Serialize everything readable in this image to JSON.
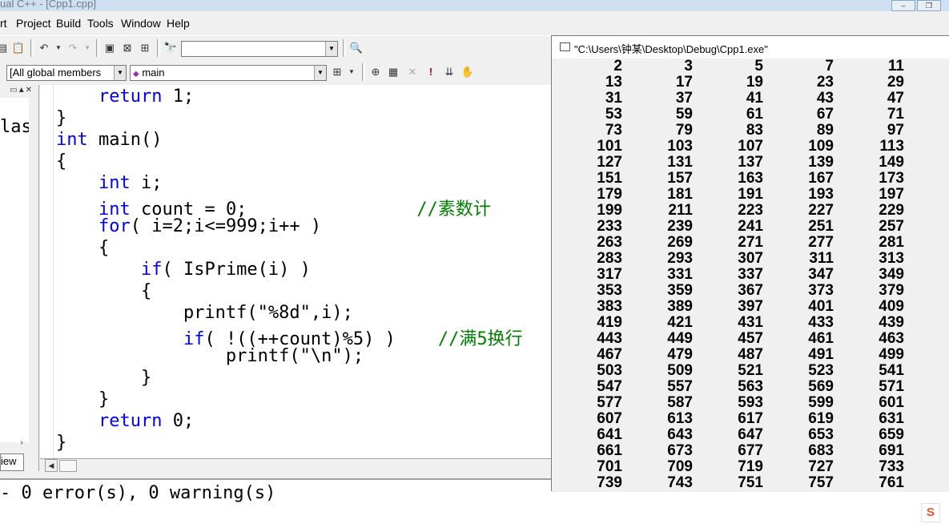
{
  "window": {
    "title": "ual C++ - [Cpp1.cpp]"
  },
  "menu": [
    "rt",
    "Project",
    "Build",
    "Tools",
    "Window",
    "Help"
  ],
  "toolbar": {
    "find_combo_value": "",
    "scope_combo": "[All global members",
    "function_combo": "main"
  },
  "left_panel": {
    "class_text": "las",
    "tab_label": "iew"
  },
  "editor": {
    "lines": [
      "    return 1;",
      "}",
      "int main()",
      "{",
      "    int i;",
      "    int count = 0;                //素数计",
      "    for( i=2;i<=999;i++ )",
      "    {",
      "        if( IsPrime(i) )",
      "        {",
      "            printf(\"%8d\",i);",
      "            if( !((++count)%5) )    //满5换行",
      "                printf(\"\\n\");",
      "        }",
      "    }",
      "    return 0;",
      "}"
    ]
  },
  "output": {
    "text": "- 0 error(s), 0 warning(s)"
  },
  "console": {
    "title": "\"C:\\Users\\钟某\\Desktop\\Debug\\Cpp1.exe\"",
    "rows": [
      [
        "2",
        "3",
        "5",
        "7",
        "11"
      ],
      [
        "13",
        "17",
        "19",
        "23",
        "29"
      ],
      [
        "31",
        "37",
        "41",
        "43",
        "47"
      ],
      [
        "53",
        "59",
        "61",
        "67",
        "71"
      ],
      [
        "73",
        "79",
        "83",
        "89",
        "97"
      ],
      [
        "101",
        "103",
        "107",
        "109",
        "113"
      ],
      [
        "127",
        "131",
        "137",
        "139",
        "149"
      ],
      [
        "151",
        "157",
        "163",
        "167",
        "173"
      ],
      [
        "179",
        "181",
        "191",
        "193",
        "197"
      ],
      [
        "199",
        "211",
        "223",
        "227",
        "229"
      ],
      [
        "233",
        "239",
        "241",
        "251",
        "257"
      ],
      [
        "263",
        "269",
        "271",
        "277",
        "281"
      ],
      [
        "283",
        "293",
        "307",
        "311",
        "313"
      ],
      [
        "317",
        "331",
        "337",
        "347",
        "349"
      ],
      [
        "353",
        "359",
        "367",
        "373",
        "379"
      ],
      [
        "383",
        "389",
        "397",
        "401",
        "409"
      ],
      [
        "419",
        "421",
        "431",
        "433",
        "439"
      ],
      [
        "443",
        "449",
        "457",
        "461",
        "463"
      ],
      [
        "467",
        "479",
        "487",
        "491",
        "499"
      ],
      [
        "503",
        "509",
        "521",
        "523",
        "541"
      ],
      [
        "547",
        "557",
        "563",
        "569",
        "571"
      ],
      [
        "577",
        "587",
        "593",
        "599",
        "601"
      ],
      [
        "607",
        "613",
        "617",
        "619",
        "631"
      ],
      [
        "641",
        "643",
        "647",
        "653",
        "659"
      ],
      [
        "661",
        "673",
        "677",
        "683",
        "691"
      ],
      [
        "701",
        "709",
        "719",
        "727",
        "733"
      ],
      [
        "739",
        "743",
        "751",
        "757",
        "761"
      ]
    ]
  },
  "tray": {
    "ime_label": "S"
  },
  "colors": {
    "keyword": "#0000ff",
    "comment": "#008000",
    "console_bg": "#f0f0f0"
  }
}
